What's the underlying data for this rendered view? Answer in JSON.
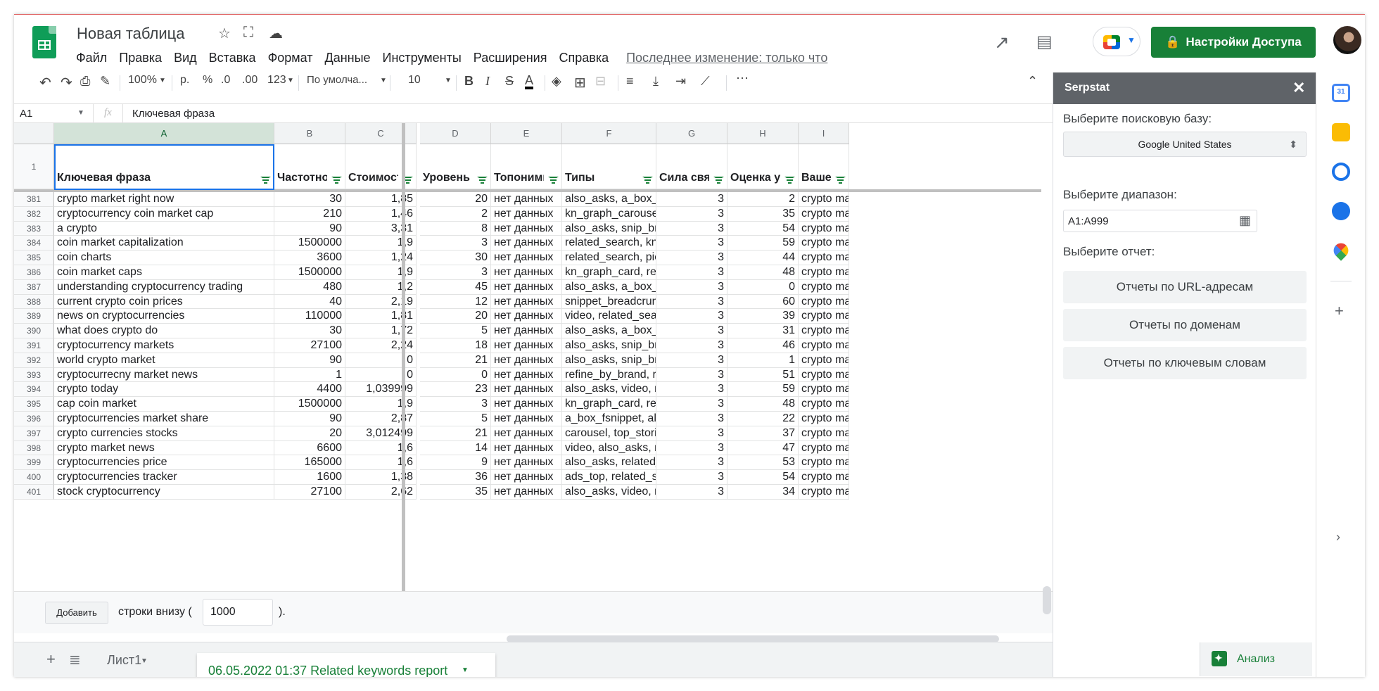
{
  "header": {
    "title": "Новая таблица",
    "menu": [
      "Файл",
      "Правка",
      "Вид",
      "Вставка",
      "Формат",
      "Данные",
      "Инструменты",
      "Расширения",
      "Справка"
    ],
    "last_edit": "Последнее изменение: только что",
    "share_label": "Настройки Доступа"
  },
  "toolbar": {
    "zoom": "100%",
    "currency": "р.",
    "percent": "%",
    "dec_less": ".0",
    "dec_more": ".00",
    "format": "123",
    "font": "По умолча...",
    "size": "10"
  },
  "formula": {
    "cell_ref": "A1",
    "fx": "fx",
    "value": "Ключевая фраза"
  },
  "columns": [
    {
      "letter": "A",
      "header": "Ключевая фраза",
      "num": false
    },
    {
      "letter": "B",
      "header": "Частотность",
      "num": true
    },
    {
      "letter": "C",
      "header": "Стоимость за клик",
      "num": true
    },
    {
      "letter": "D",
      "header": "Уровень конкуренции",
      "num": true
    },
    {
      "letter": "E",
      "header": "Топонимы",
      "num": false
    },
    {
      "letter": "F",
      "header": "Типы",
      "num": false
    },
    {
      "letter": "G",
      "header": "Сила связи",
      "num": true
    },
    {
      "letter": "H",
      "header": "Оценка уровня",
      "num": true
    },
    {
      "letter": "I",
      "header": "Ваше запрос",
      "num": false
    }
  ],
  "header_row_number": "1",
  "rows": [
    [
      "381",
      "crypto market right now",
      "30",
      "1,85",
      "20",
      "нет данных",
      "also_asks, a_box_fsnippet",
      "3",
      "2",
      "crypto market"
    ],
    [
      "382",
      "cryptocurrency coin market cap",
      "210",
      "1,46",
      "2",
      "нет данных",
      "kn_graph_carousel_list",
      "3",
      "35",
      "crypto market"
    ],
    [
      "383",
      "a crypto",
      "90",
      "3,31",
      "8",
      "нет данных",
      "also_asks, snip_breadcrumbs",
      "3",
      "54",
      "crypto market"
    ],
    [
      "384",
      "coin market capitalization",
      "1500000",
      "1,9",
      "3",
      "нет данных",
      "related_search, kn_graph",
      "3",
      "59",
      "crypto market"
    ],
    [
      "385",
      "coin charts",
      "3600",
      "1,24",
      "30",
      "нет данных",
      "related_search, pic, snippet",
      "3",
      "44",
      "crypto market"
    ],
    [
      "386",
      "coin market caps",
      "1500000",
      "1,9",
      "3",
      "нет данных",
      "kn_graph_card, related",
      "3",
      "48",
      "crypto market"
    ],
    [
      "387",
      "understanding cryptocurrency trading",
      "480",
      "1,2",
      "45",
      "нет данных",
      "also_asks, a_box_fsnippet",
      "3",
      "0",
      "crypto market"
    ],
    [
      "388",
      "current crypto coin prices",
      "40",
      "2,19",
      "12",
      "нет данных",
      "snippet_breadcrumbs",
      "3",
      "60",
      "crypto market"
    ],
    [
      "389",
      "news on cryptocurrencies",
      "110000",
      "1,81",
      "20",
      "нет данных",
      "video, related_search,",
      "3",
      "39",
      "crypto market"
    ],
    [
      "390",
      "what does crypto do",
      "30",
      "1,72",
      "5",
      "нет данных",
      "also_asks, a_box_fsnippet",
      "3",
      "31",
      "crypto market"
    ],
    [
      "391",
      "cryptocurrency markets",
      "27100",
      "2,24",
      "18",
      "нет данных",
      "also_asks, snip_breadcrumbs",
      "3",
      "46",
      "crypto market"
    ],
    [
      "392",
      "world crypto market",
      "90",
      "0",
      "21",
      "нет данных",
      "also_asks, snip_breadcrumbs",
      "3",
      "1",
      "crypto market"
    ],
    [
      "393",
      "cryptocurrecny market news",
      "1",
      "0",
      "0",
      "нет данных",
      "refine_by_brand, related",
      "3",
      "51",
      "crypto market"
    ],
    [
      "394",
      "crypto today",
      "4400",
      "1,039999",
      "23",
      "нет данных",
      "also_asks, video, related",
      "3",
      "59",
      "crypto market"
    ],
    [
      "395",
      "cap coin market",
      "1500000",
      "1,9",
      "3",
      "нет данных",
      "kn_graph_card, related",
      "3",
      "48",
      "crypto market"
    ],
    [
      "396",
      "cryptocurrencies market share",
      "90",
      "2,87",
      "5",
      "нет данных",
      "a_box_fsnippet, also_asks",
      "3",
      "22",
      "crypto market"
    ],
    [
      "397",
      "crypto currencies stocks",
      "20",
      "3,012499",
      "21",
      "нет данных",
      "carousel, top_stories,",
      "3",
      "37",
      "crypto market"
    ],
    [
      "398",
      "crypto market news",
      "6600",
      "1,6",
      "14",
      "нет данных",
      "video, also_asks, related",
      "3",
      "47",
      "crypto market"
    ],
    [
      "399",
      "cryptocurrencies price",
      "165000",
      "1,6",
      "9",
      "нет данных",
      "also_asks, related_search",
      "3",
      "53",
      "crypto market"
    ],
    [
      "400",
      "cryptocurrencies tracker",
      "1600",
      "1,38",
      "36",
      "нет данных",
      "ads_top, related_search",
      "3",
      "54",
      "crypto market"
    ],
    [
      "401",
      "stock cryptocurrency",
      "27100",
      "2,62",
      "35",
      "нет данных",
      "also_asks, video, related",
      "3",
      "34",
      "crypto market"
    ]
  ],
  "add_rows": {
    "button": "Добавить",
    "text_before": "строки внизу (",
    "value": "1000",
    "text_after": ")."
  },
  "sheets": {
    "sheet1": "Лист1",
    "sheet2": "06.05.2022 01:37 Related keywords report",
    "explore": "Анализ данных"
  },
  "panel": {
    "title": "Serpstat",
    "db_label": "Выберите поисковую базу:",
    "db_value": "Google United States",
    "range_label": "Выберите диапазон:",
    "range_value": "A1:A999",
    "report_label": "Выберите отчет:",
    "buttons": [
      "Отчеты по URL-адресам",
      "Отчеты по доменам",
      "Отчеты по ключевым словам"
    ]
  }
}
